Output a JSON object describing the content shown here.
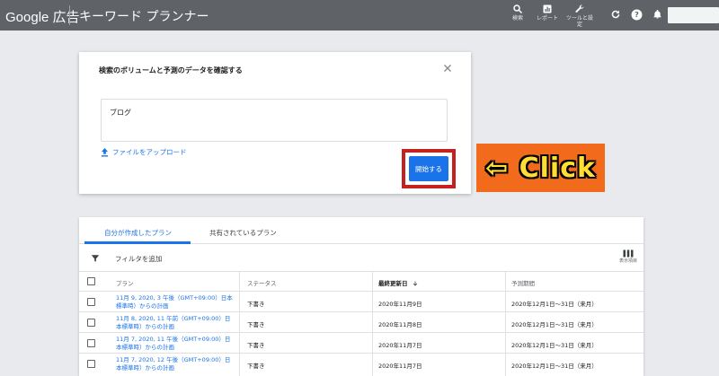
{
  "header": {
    "logo": "Google 広告",
    "title": "キーワード プランナー",
    "tools": [
      {
        "icon": "search-icon",
        "label": "検索"
      },
      {
        "icon": "report-icon",
        "label": "レポート"
      },
      {
        "icon": "wrench-icon",
        "label": "ツールと設定"
      }
    ]
  },
  "dialog": {
    "title": "検索のボリュームと予測のデータを確認する",
    "keyword_value": "ブログ",
    "upload_label": "ファイルをアップロード",
    "start_label": "開始する"
  },
  "callout": {
    "text": "⇦ Click",
    "bg_color": "#f26a1b",
    "text_color": "#ffdd33"
  },
  "plans": {
    "tabs": [
      {
        "label": "自分が作成したプラン",
        "active": true
      },
      {
        "label": "共有されているプラン",
        "active": false
      }
    ],
    "filter_label": "フィルタを追加",
    "columns_label": "表示項目",
    "columns": [
      "プラン",
      "ステータス",
      "最終更新日",
      "予測期間"
    ],
    "rows": [
      {
        "plan": "11月 9, 2020, 3 午後（GMT+09:00）日本標準時）からの計画",
        "status": "下書き",
        "updated": "2020年11月9日",
        "period": "2020年12月1日～31日（来月）"
      },
      {
        "plan": "11月 8, 2020, 11 午前（GMT+09:00）日本標準時）からの計画",
        "status": "下書き",
        "updated": "2020年11月8日",
        "period": "2020年12月1日～31日（来月）"
      },
      {
        "plan": "11月 7, 2020, 11 午後（GMT+09:00）日本標準時）からの計画",
        "status": "下書き",
        "updated": "2020年11月7日",
        "period": "2020年12月1日～31日（来月）"
      },
      {
        "plan": "11月 7, 2020, 12 午後（GMT+09:00）日本標準時）からの計画",
        "status": "下書き",
        "updated": "2020年11月7日",
        "period": "2020年12月1日～31日（来月）"
      }
    ]
  },
  "colors": {
    "topbar": "#5f6368",
    "accent": "#1a73e8",
    "highlight_frame": "#c5221f"
  }
}
